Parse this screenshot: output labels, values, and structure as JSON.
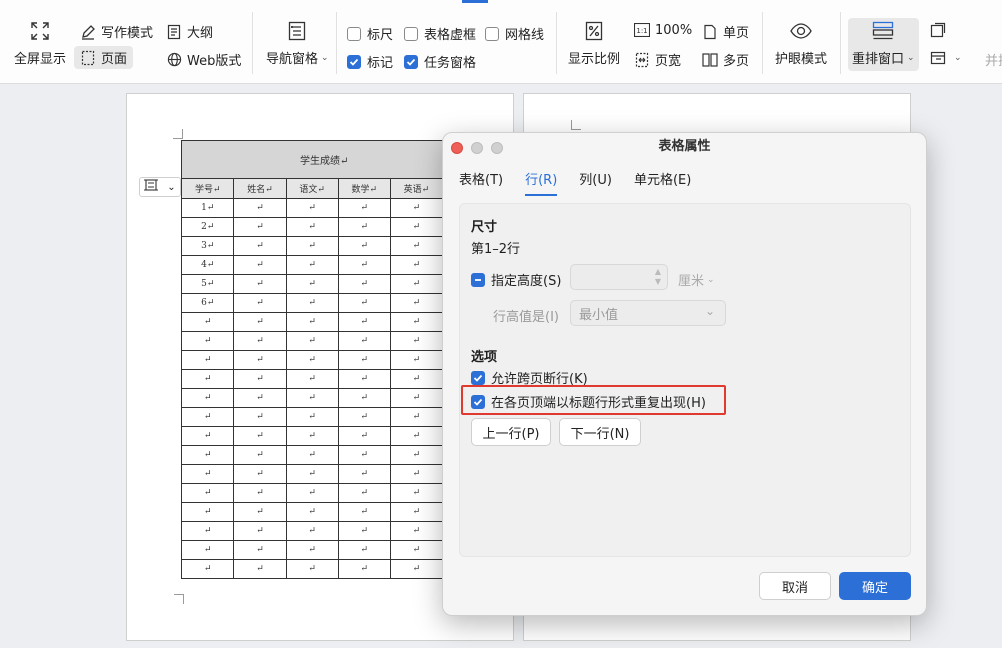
{
  "ribbon": {
    "fullscreen": "全屏显示",
    "writing_mode": "写作模式",
    "outline": "大纲",
    "page": "页面",
    "web_layout": "Web版式",
    "nav_pane": "导航窗格",
    "ruler": "标尺",
    "table_gridlines": "表格虚框",
    "gridlines": "网格线",
    "mark": "标记",
    "task_pane": "任务窗格",
    "zoom_ratio": "显示比例",
    "zoom_100": "100%",
    "page_width": "页宽",
    "single_page": "单页",
    "multi_page": "多页",
    "eye_care": "护眼模式",
    "rearrange_window": "重排窗口",
    "cut_text": "并排"
  },
  "document": {
    "table_title": "学生成绩",
    "columns": [
      "学号",
      "姓名",
      "语文",
      "数学",
      "英语"
    ],
    "row_numbers": [
      "1",
      "2",
      "3",
      "4",
      "5",
      "6"
    ],
    "cell_mark": "↵"
  },
  "dialog": {
    "title": "表格属性",
    "tabs": [
      "表格(T)",
      "行(R)",
      "列(U)",
      "单元格(E)"
    ],
    "active_tab": "行(R)",
    "size_section": "尺寸",
    "row_range": "第1–2行",
    "specify_height": "指定高度(S)",
    "height_unit": "厘米",
    "row_height_is": "行高值是(I)",
    "row_height_value": "最小值",
    "options_section": "选项",
    "allow_break": "允许跨页断行(K)",
    "repeat_header": "在各页顶端以标题行形式重复出现(H)",
    "prev_row": "上一行(P)",
    "next_row": "下一行(N)",
    "cancel": "取消",
    "ok": "确定"
  },
  "colors": {
    "accent": "#2c6fd6",
    "highlight": "#e0392f",
    "close": "#ee5f57",
    "minimize": "#c9c9c9"
  }
}
